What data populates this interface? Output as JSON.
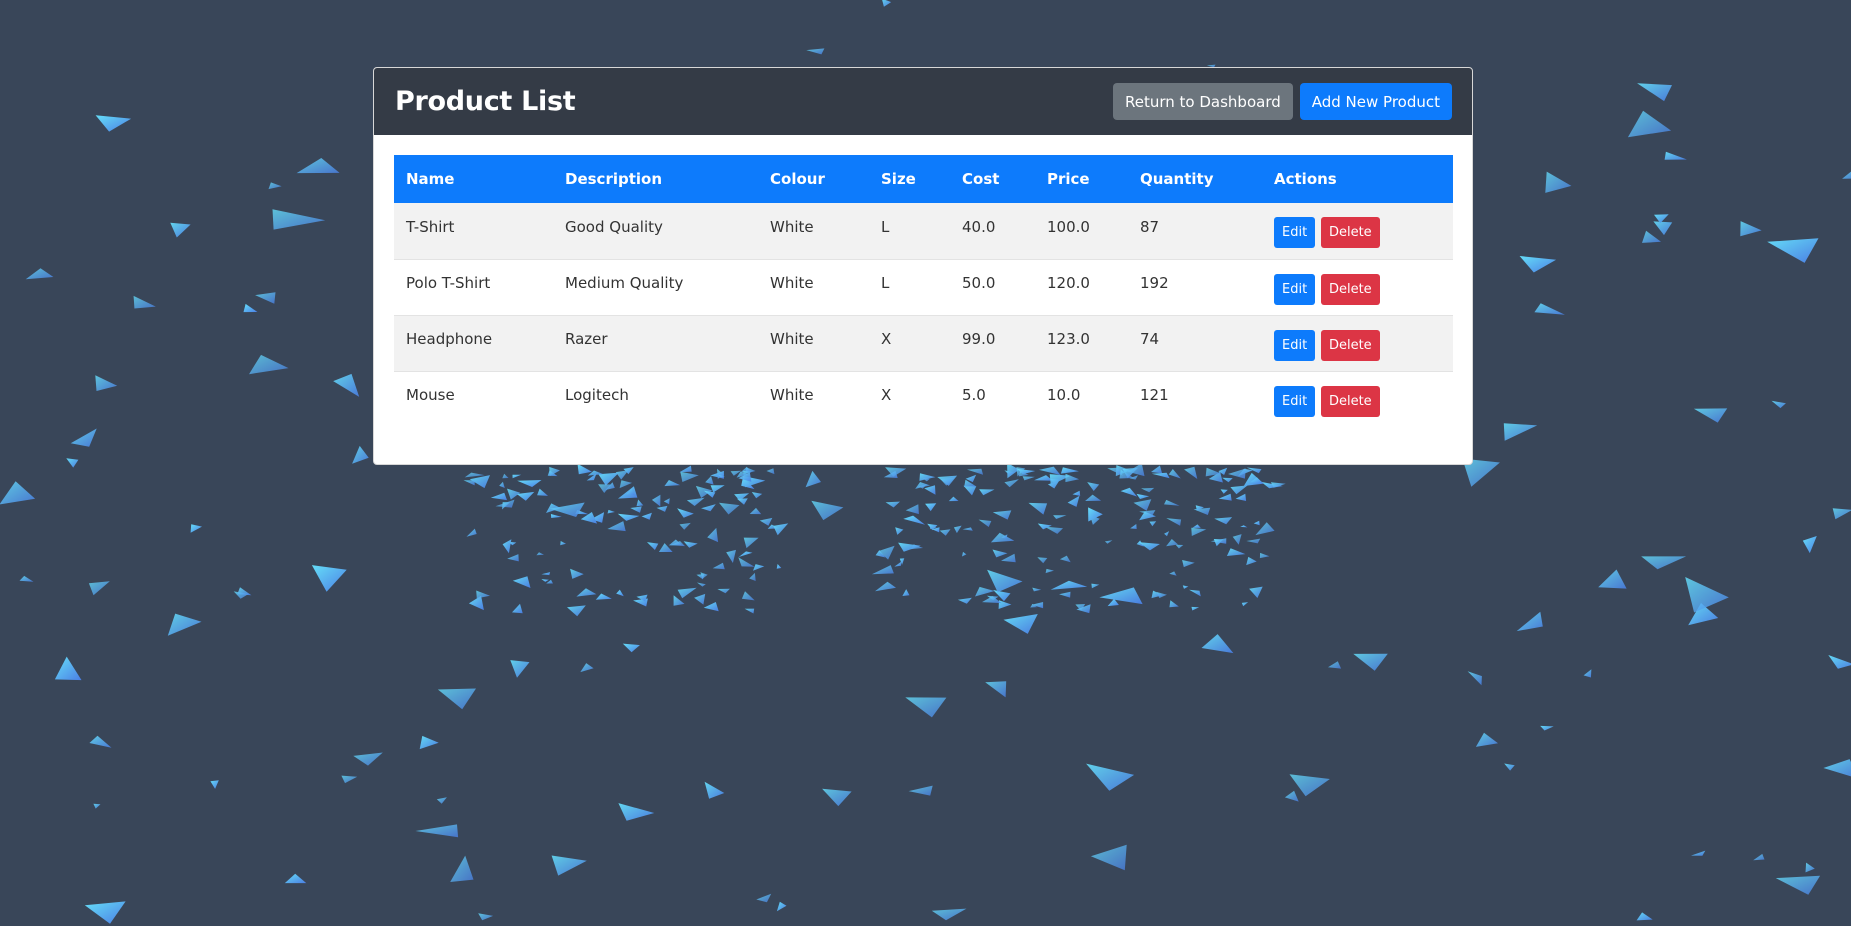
{
  "header": {
    "title": "Product List",
    "return_label": "Return to Dashboard",
    "add_label": "Add New Product"
  },
  "table": {
    "columns": [
      "Name",
      "Description",
      "Colour",
      "Size",
      "Cost",
      "Price",
      "Quantity",
      "Actions"
    ],
    "rows": [
      [
        "T-Shirt",
        "Good Quality",
        "White",
        "L",
        "40.0",
        "100.0",
        "87"
      ],
      [
        "Polo T-Shirt",
        "Medium Quality",
        "White",
        "L",
        "50.0",
        "120.0",
        "192"
      ],
      [
        "Headphone",
        "Razer",
        "White",
        "X",
        "99.0",
        "123.0",
        "74"
      ],
      [
        "Mouse",
        "Logitech",
        "White",
        "X",
        "5.0",
        "10.0",
        "121"
      ]
    ],
    "edit_label": "Edit",
    "delete_label": "Delete"
  },
  "colors": {
    "background": "#394659",
    "header_bg": "#343b46",
    "primary": "#0d7bfc",
    "secondary": "#6c757d",
    "danger": "#dc3545",
    "particle_light": "#5fd8f7",
    "particle_dark": "#4a86e8"
  }
}
